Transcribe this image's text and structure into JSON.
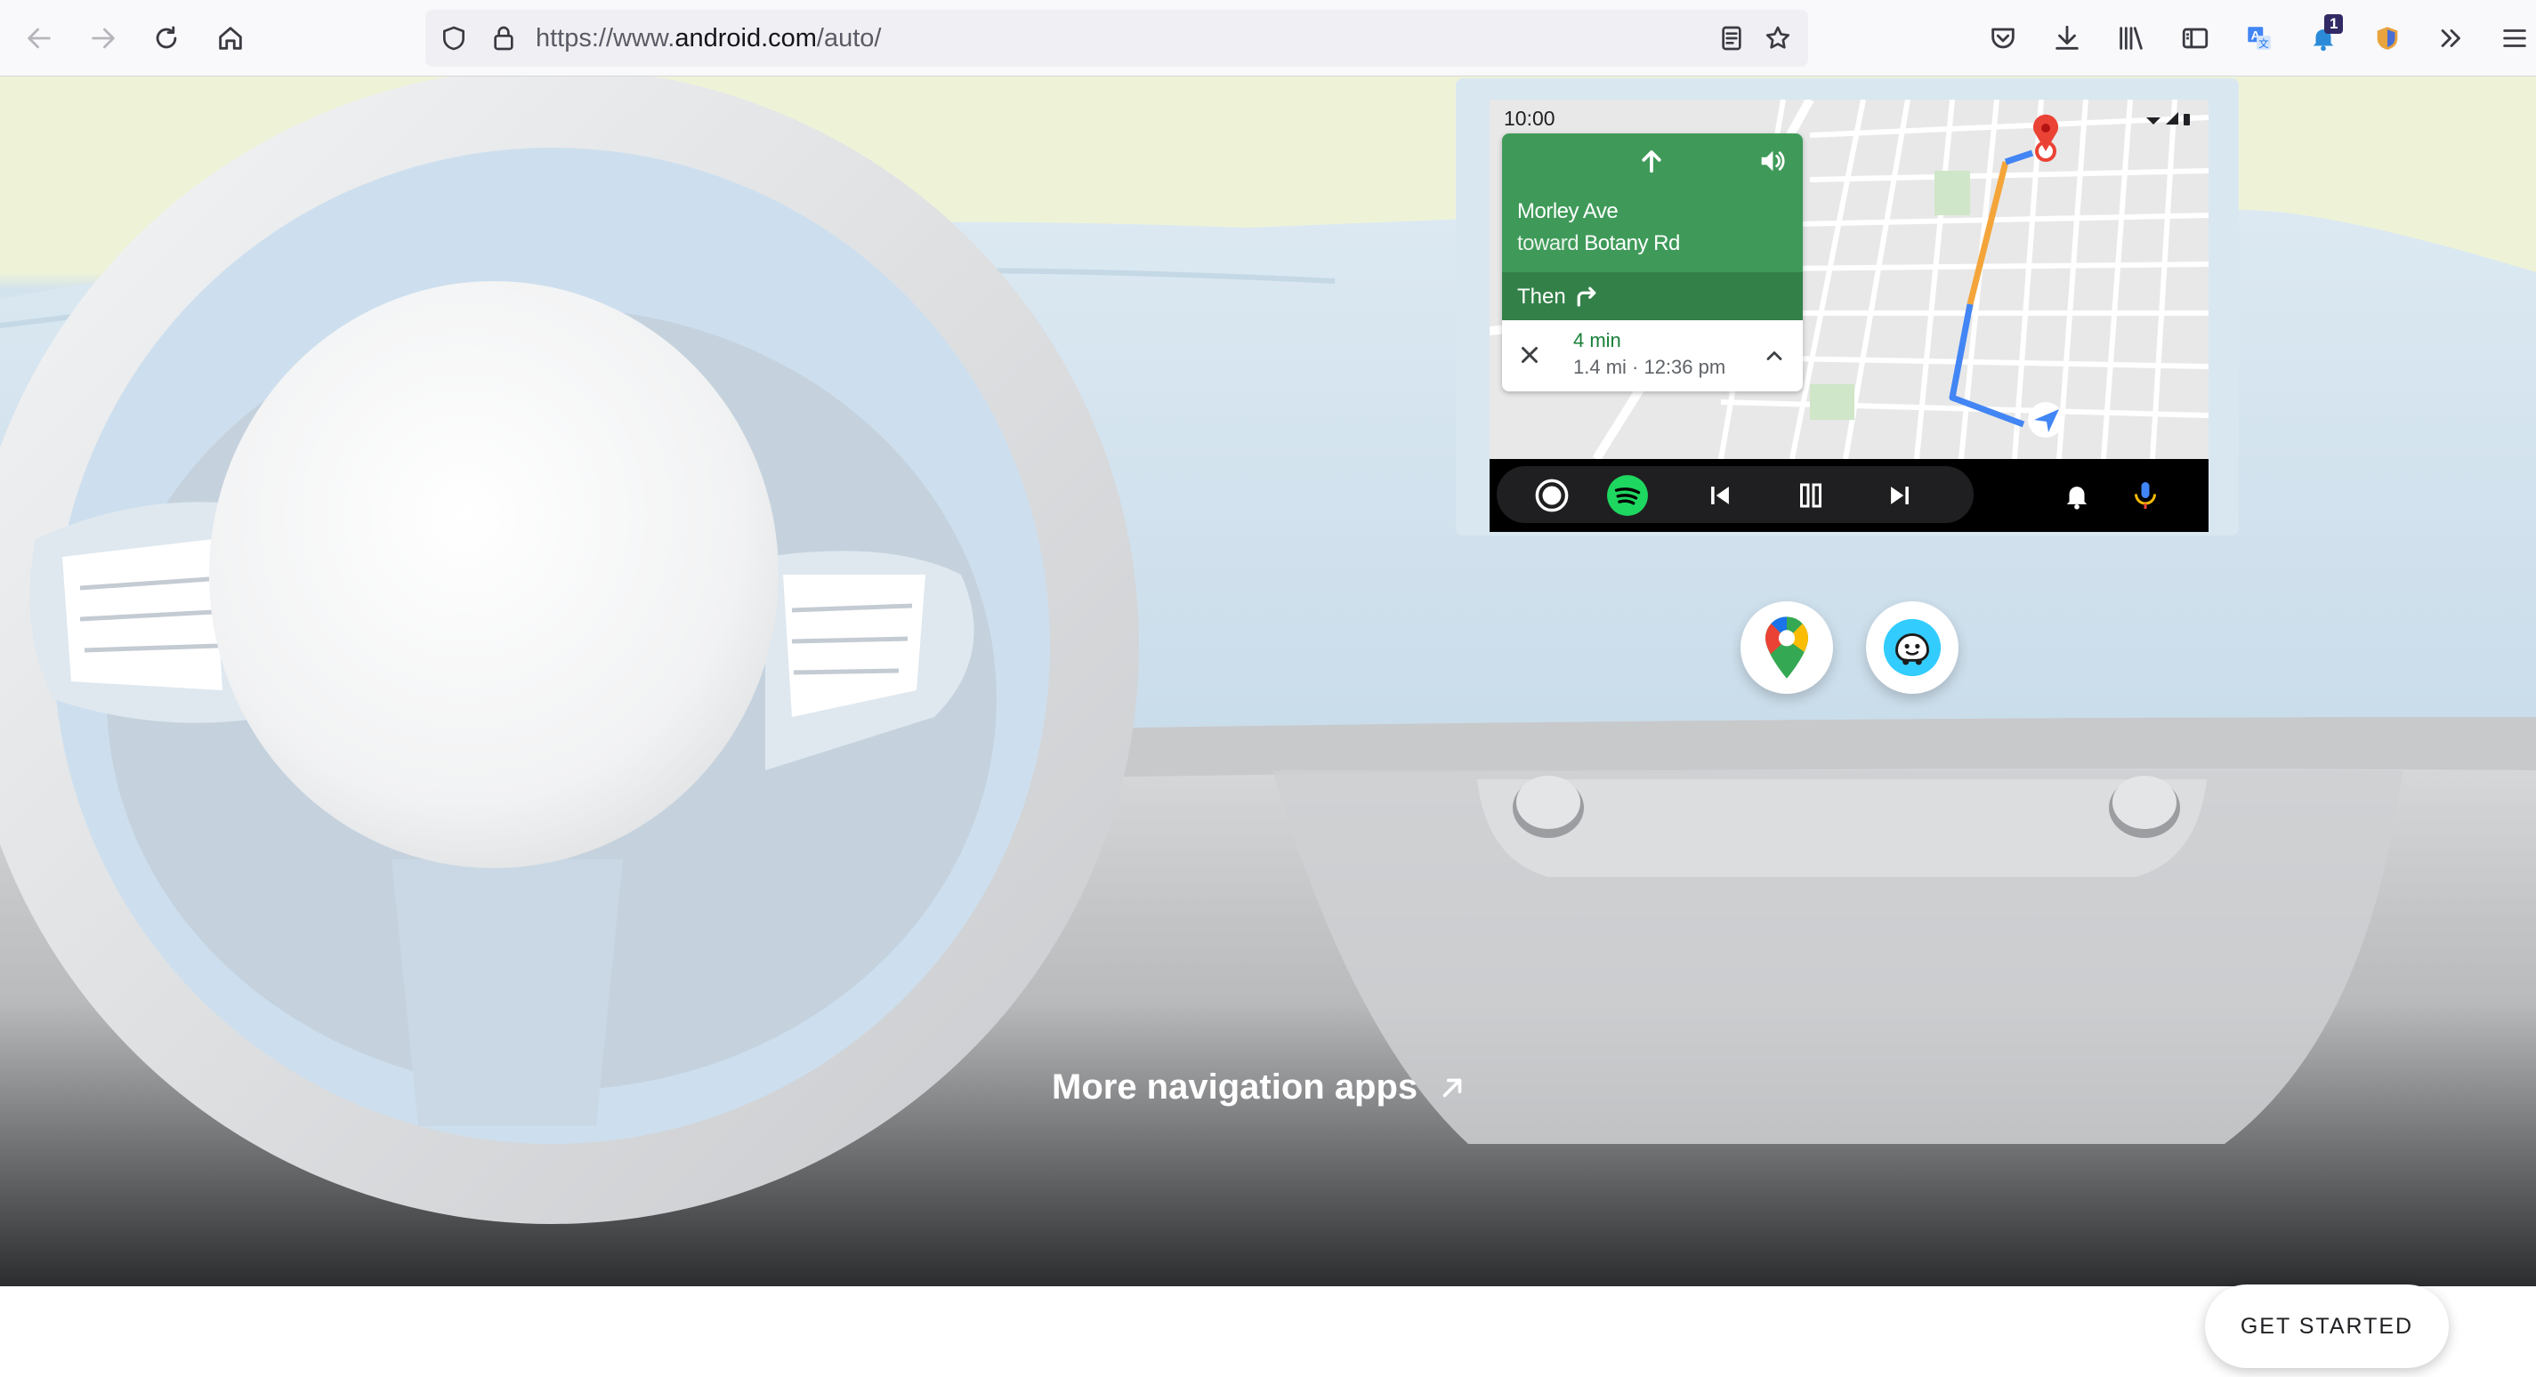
{
  "browser": {
    "url_prefix": "https://www.",
    "url_host": "android.com",
    "url_path": "/auto/",
    "extension_badge": "1"
  },
  "car_display": {
    "status_time": "10:00",
    "navigation": {
      "street": "Morley Ave",
      "toward_prefix": "toward",
      "toward_street": "Botany Rd",
      "then_label": "Then",
      "eta_minutes": "4 min",
      "eta_detail": "1.4 mi · 12:36 pm"
    }
  },
  "nav_apps": [
    "Google Maps",
    "Waze"
  ],
  "more_link": "More navigation apps",
  "cta": "GET STARTED",
  "colors": {
    "nav_green": "#3f9a59",
    "route_blue": "#4285f4",
    "route_orange": "#f4a53a",
    "spotify_green": "#1ed760"
  }
}
